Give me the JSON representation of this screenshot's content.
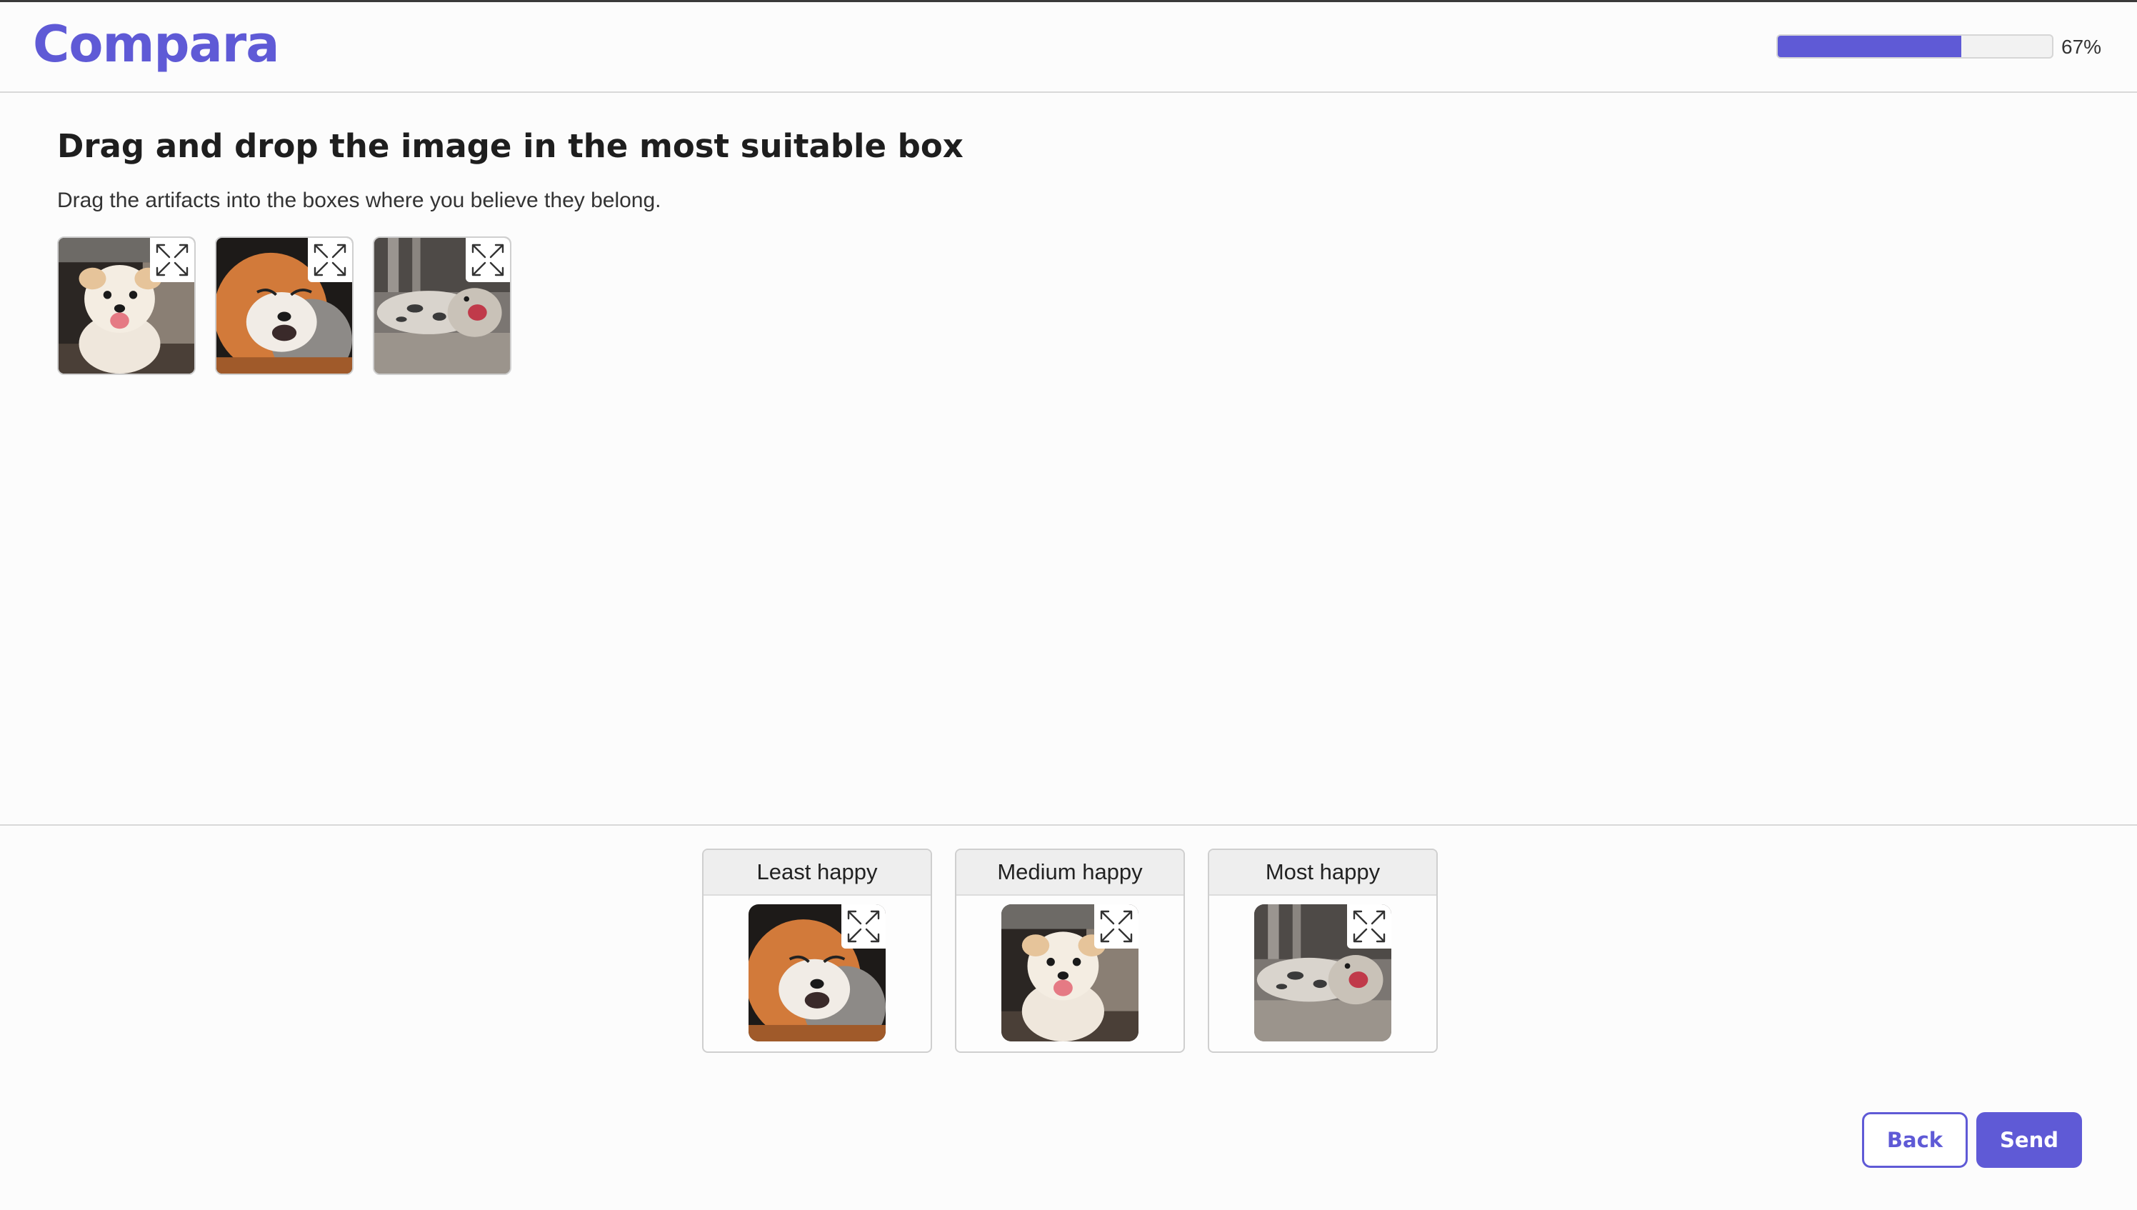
{
  "app": {
    "logo_text": "Compara"
  },
  "progress": {
    "percent": 67,
    "label": "67%"
  },
  "task": {
    "title": "Drag and drop the image in the most suitable box",
    "instructions": "Drag the artifacts into the boxes where you believe they belong."
  },
  "pool_images": [
    {
      "subject": "dog"
    },
    {
      "subject": "fox"
    },
    {
      "subject": "seal"
    }
  ],
  "slots": [
    {
      "label": "Least happy",
      "image": "fox"
    },
    {
      "label": "Medium happy",
      "image": "dog"
    },
    {
      "label": "Most happy",
      "image": "seal"
    }
  ],
  "buttons": {
    "back": "Back",
    "send": "Send"
  },
  "colors": {
    "accent": "#5f5ad6"
  },
  "icons": {
    "expand": "expand-icon"
  }
}
